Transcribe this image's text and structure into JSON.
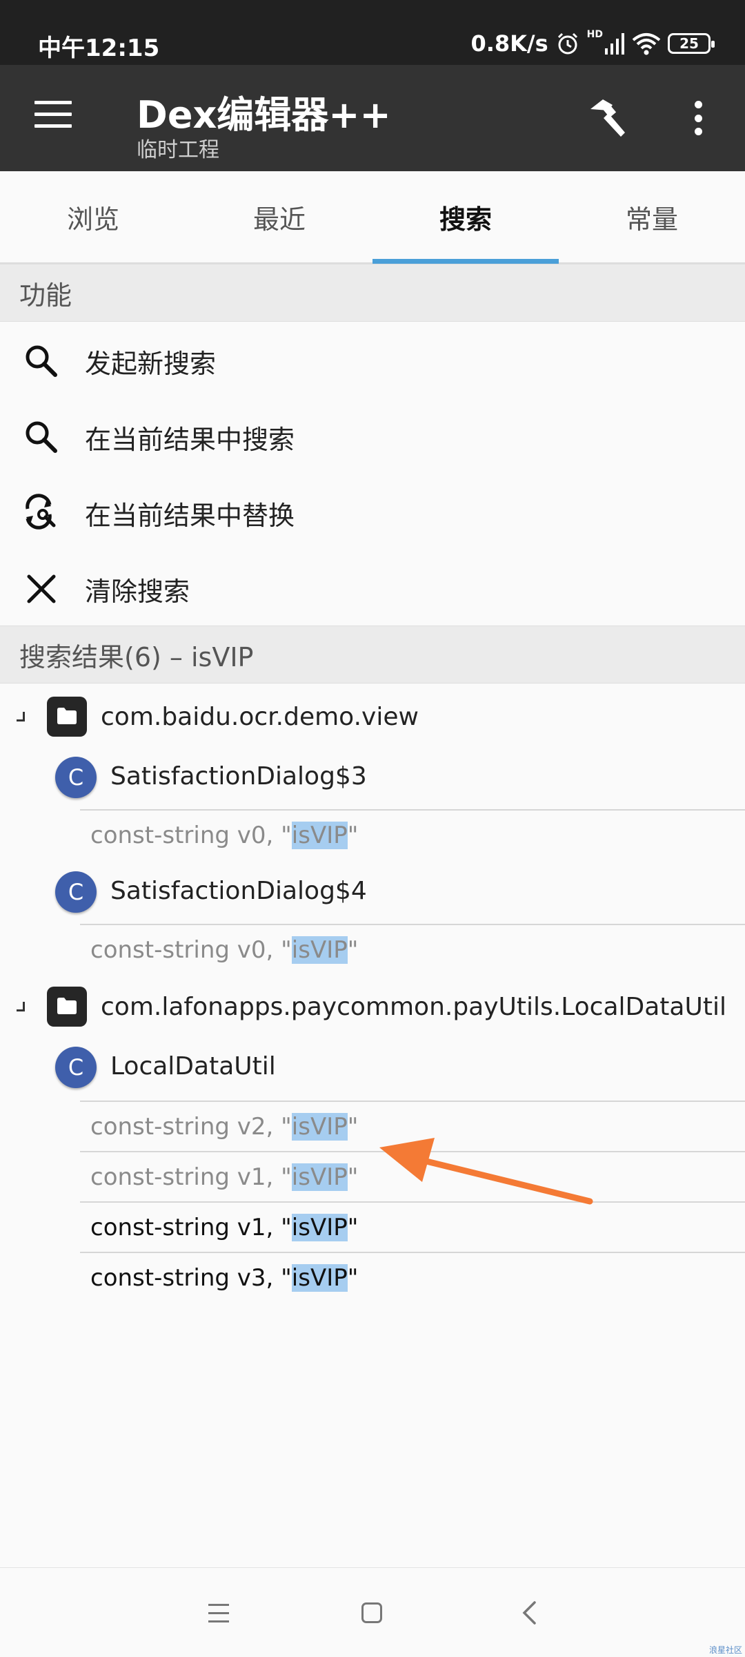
{
  "status_bar": {
    "time": "中午12:15",
    "net_speed": "0.8K/s",
    "network_badge": "HD",
    "battery": "25",
    "icons": [
      "alarm-icon",
      "signal-icon",
      "wifi-icon",
      "battery-icon"
    ]
  },
  "toolbar": {
    "title": "Dex编辑器++",
    "subtitle": "临时工程",
    "icons": [
      "menu-icon",
      "hammer-icon",
      "more-vertical-icon"
    ]
  },
  "tabs": [
    {
      "label": "浏览",
      "active": false
    },
    {
      "label": "最近",
      "active": false
    },
    {
      "label": "搜索",
      "active": true
    },
    {
      "label": "常量",
      "active": false
    }
  ],
  "functions": {
    "header": "功能",
    "items": [
      {
        "label": "发起新搜索",
        "icon": "search-icon"
      },
      {
        "label": "在当前结果中搜索",
        "icon": "search-icon"
      },
      {
        "label": "在当前结果中替换",
        "icon": "replace-icon"
      },
      {
        "label": "清除搜索",
        "icon": "close-icon"
      }
    ]
  },
  "results": {
    "header": "搜索结果(6) – isVIP",
    "packages": [
      {
        "name": "com.baidu.ocr.demo.view",
        "classes": [
          {
            "badge": "C",
            "name": "SatisfactionDialog$3",
            "matches": [
              {
                "prefix": "const-string v0, \"",
                "match": "isVIP",
                "suffix": "\""
              }
            ]
          },
          {
            "badge": "C",
            "name": "SatisfactionDialog$4",
            "matches": [
              {
                "prefix": "const-string v0, \"",
                "match": "isVIP",
                "suffix": "\""
              }
            ]
          }
        ]
      },
      {
        "name": "com.lafonapps.paycommon.payUtils.LocalDataUtil",
        "classes": [
          {
            "badge": "C",
            "name": "LocalDataUtil",
            "matches": [
              {
                "prefix": "const-string v2, \"",
                "match": "isVIP",
                "suffix": "\""
              },
              {
                "prefix": "const-string v1, \"",
                "match": "isVIP",
                "suffix": "\""
              },
              {
                "prefix": "const-string v1, \"",
                "match": "isVIP",
                "suffix": "\""
              },
              {
                "prefix": "const-string v3, \"",
                "match": "isVIP",
                "suffix": "\""
              }
            ]
          }
        ]
      }
    ]
  },
  "annotation_color": "#f47a35",
  "accent_color": "#4a9fd8",
  "watermark": "浪星社区"
}
